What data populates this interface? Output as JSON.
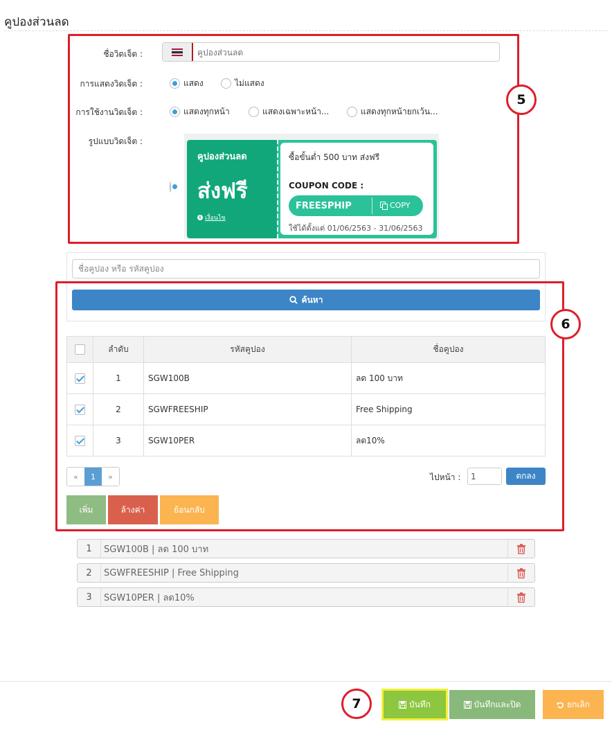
{
  "page": {
    "title": "คูปองส่วนลด"
  },
  "widget_form": {
    "name_label": "ชื่อวิดเจ็ต :",
    "name_value": "",
    "name_placeholder": "คูปองส่วนลด",
    "display_label": "การแสดงวิดเจ็ต :",
    "display_options": [
      "แสดง",
      "ไม่แสดง"
    ],
    "display_selected": "แสดง",
    "usage_label": "การใช้งานวิดเจ็ต :",
    "usage_options": [
      "แสดงทุกหน้า",
      "แสดงเฉพาะหน้า...",
      "แสดงทุกหน้ายกเว้น..."
    ],
    "usage_selected": "แสดงทุกหน้า",
    "style_label": "รูปแบบวิดเจ็ต :"
  },
  "coupon_preview": {
    "heading": "คูปองส่วนลด",
    "big_text": "ส่งฟรี",
    "conditions_link": "เงื่อนไข",
    "description": "ซื้อขั้นต่ำ 500 บาท ส่งฟรี",
    "code_label": "COUPON CODE :",
    "code": "FREESPHIP",
    "copy_label": "COPY",
    "validity": "ใช้ได้ตั้งแต่ 01/06/2563 - 31/06/2563",
    "colors": {
      "dark": "#11a77a",
      "light": "#2bc29a"
    }
  },
  "search": {
    "placeholder": "ชื่อคูปอง หรือ รหัสคูปอง",
    "button_label": "ค้นหา"
  },
  "coupon_table": {
    "headers": [
      "ลำดับ",
      "รหัสคูปอง",
      "ชื่อคูปอง"
    ],
    "rows": [
      {
        "no": "1",
        "code": "SGW100B",
        "name": "ลด 100 บาท",
        "checked": true
      },
      {
        "no": "2",
        "code": "SGWFREESHIP",
        "name": "Free Shipping",
        "checked": true
      },
      {
        "no": "3",
        "code": "SGW10PER",
        "name": "ลด10%",
        "checked": true
      }
    ]
  },
  "pagination": {
    "prev": "«",
    "current": "1",
    "next": "»",
    "goto_label": "ไปหน้า :",
    "goto_value": "1",
    "goto_button": "ตกลง"
  },
  "actions": {
    "add": "เพิ่ม",
    "clear": "ล้างค่า",
    "back": "ย้อนกลับ"
  },
  "selected_items": [
    {
      "no": "1",
      "text": "SGW100B | ลด 100 บาท"
    },
    {
      "no": "2",
      "text": "SGWFREESHIP | Free Shipping"
    },
    {
      "no": "3",
      "text": "SGW10PER | ลด10%"
    }
  ],
  "footer": {
    "save": "บันทึก",
    "save_close": "บันทึกและปิด",
    "cancel": "ยกเลิก"
  },
  "callouts": [
    "5",
    "6",
    "7"
  ],
  "colors": {
    "callout_red": "#dd1e2a",
    "primary_blue": "#3d85c6",
    "save_green": "#8dc63f",
    "save_close_green": "#89b97a",
    "cancel_orange": "#fbb450",
    "add_green": "#8fbc82",
    "clear_red": "#d9604c",
    "back_orange": "#fbb450"
  }
}
